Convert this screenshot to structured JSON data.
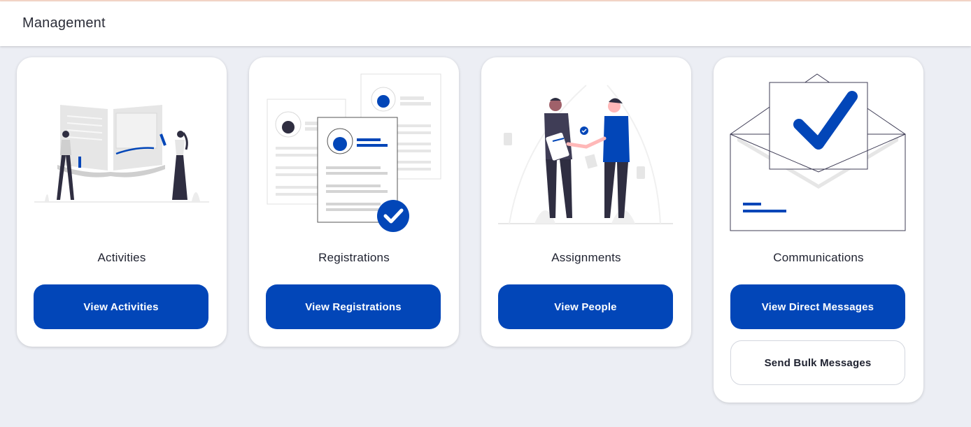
{
  "header": {
    "title": "Management"
  },
  "cards": [
    {
      "title": "Activities",
      "primary_button": "View Activities",
      "illustration": "open-book-illustration"
    },
    {
      "title": "Registrations",
      "primary_button": "View Registrations",
      "illustration": "profile-documents-illustration"
    },
    {
      "title": "Assignments",
      "primary_button": "View People",
      "illustration": "handshake-illustration"
    },
    {
      "title": "Communications",
      "primary_button": "View Direct Messages",
      "secondary_button": "Send Bulk Messages",
      "illustration": "envelope-check-illustration"
    }
  ],
  "colors": {
    "accent": "#0246b8",
    "background": "#eceef4",
    "card": "#ffffff"
  }
}
